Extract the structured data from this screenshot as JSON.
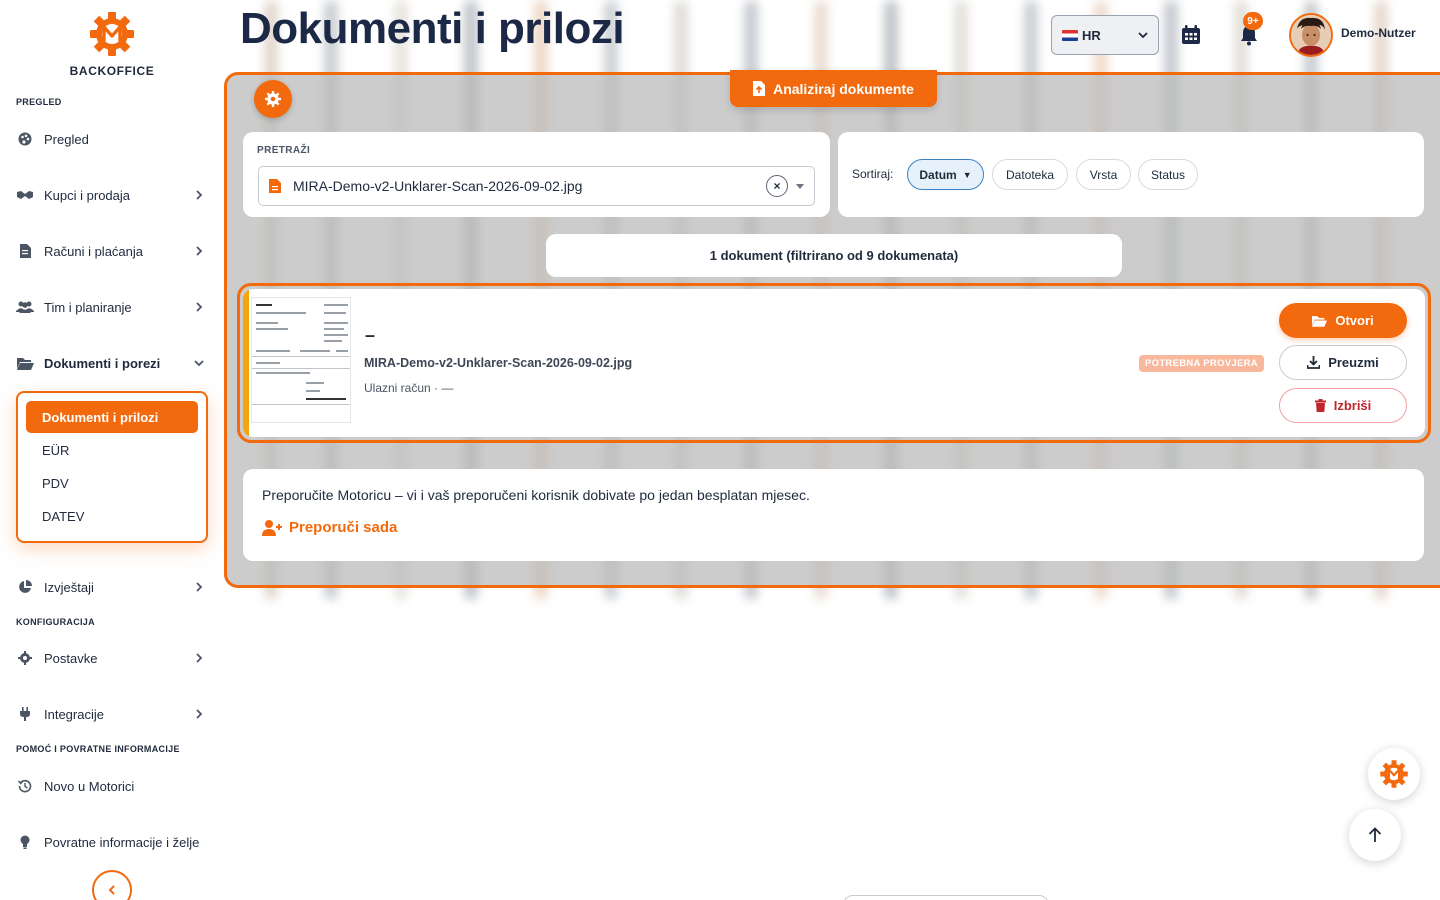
{
  "brand": {
    "name": "BACKOFFICE",
    "accent": "#f26a0d",
    "navy": "#1b2947"
  },
  "sidebar": {
    "sections": {
      "overview": "PREGLED",
      "configuration": "KONFIGURACIJA",
      "help": "POMOĆ I POVRATNE INFORMACIJE"
    },
    "items": [
      {
        "label": "Pregled",
        "icon": "palette-icon"
      },
      {
        "label": "Kupci i prodaja",
        "icon": "handshake-icon"
      },
      {
        "label": "Računi i plaćanja",
        "icon": "invoice-icon"
      },
      {
        "label": "Tim i planiranje",
        "icon": "users-icon"
      },
      {
        "label": "Dokumenti i porezi",
        "icon": "folder-open-icon"
      },
      {
        "label": "Izvještaji",
        "icon": "pie-chart-icon"
      },
      {
        "label": "Postavke",
        "icon": "gear-icon"
      },
      {
        "label": "Integracije",
        "icon": "plug-icon"
      },
      {
        "label": "Novo u Motorici",
        "icon": "history-icon"
      },
      {
        "label": "Povratne informacije i želje",
        "icon": "lightbulb-icon"
      }
    ],
    "submenu": [
      {
        "label": "Dokumenti i prilozi",
        "active": true
      },
      {
        "label": "EÜR"
      },
      {
        "label": "PDV"
      },
      {
        "label": "DATEV"
      }
    ]
  },
  "header": {
    "title": "Dokumenti i prilozi",
    "language": "HR",
    "notifications_badge": "9+",
    "user_name": "Demo-Nutzer"
  },
  "toolbar": {
    "analyze_label": "Analiziraj dokumente"
  },
  "search": {
    "label": "PRETRAŽI",
    "value": "MIRA-Demo-v2-Unklarer-Scan-2026-09-02.jpg",
    "clear_symbol": "×"
  },
  "sort": {
    "label": "Sortiraj:",
    "options": [
      {
        "label": "Datum",
        "active": true,
        "direction": "▼"
      },
      {
        "label": "Datoteka"
      },
      {
        "label": "Vrsta"
      },
      {
        "label": "Status"
      }
    ]
  },
  "results": {
    "count_text": "1 dokument (filtrirano od 9 dokumenata)"
  },
  "documents": [
    {
      "title": "–",
      "filename": "MIRA-Demo-v2-Unklarer-Scan-2026-09-02.jpg",
      "meta": "Ulazni račun · —",
      "status": "POTREBNA PROVJERA",
      "actions": {
        "open": "Otvori",
        "download": "Preuzmi",
        "delete": "Izbriši"
      }
    }
  ],
  "referral": {
    "text": "Preporučite Motoricu – vi i vaš preporučeni korisnik dobivate po jedan besplatan mjesec.",
    "link": "Preporuči sada"
  }
}
